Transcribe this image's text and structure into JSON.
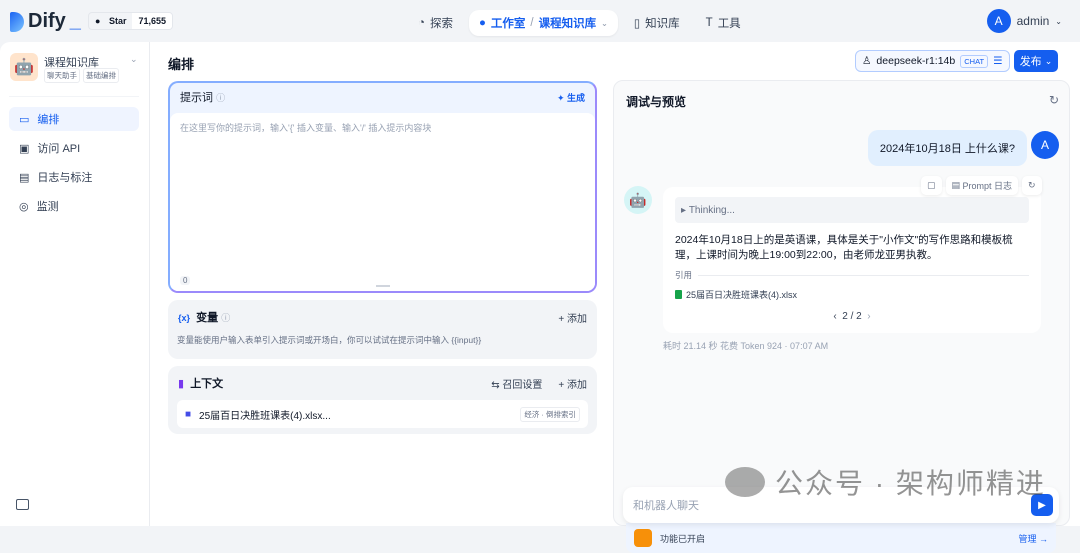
{
  "header": {
    "brand": "Dify",
    "github_star_label": "Star",
    "github_star_count": "71,655",
    "nav": [
      {
        "label": "探索",
        "icon": "compass-icon"
      },
      {
        "label": "工作室",
        "icon": "robot-icon"
      },
      {
        "label": "课程知识库"
      },
      {
        "label": "知识库",
        "icon": "book-icon"
      },
      {
        "label": "工具",
        "icon": "hammer-icon"
      }
    ],
    "breadcrumb_sep": "/",
    "user": {
      "initial": "A",
      "name": "admin"
    }
  },
  "sidebar": {
    "app_name": "课程知识库",
    "tags": [
      "聊天助手",
      "基础编排"
    ],
    "items": [
      {
        "label": "编排",
        "active": true
      },
      {
        "label": "访问 API"
      },
      {
        "label": "日志与标注"
      },
      {
        "label": "监测"
      }
    ]
  },
  "main": {
    "title": "编排",
    "model": {
      "name": "deepseek-r1:14b",
      "badge": "CHAT"
    },
    "publish_label": "发布",
    "prompt": {
      "label": "提示词",
      "generate": "生成",
      "placeholder": "在这里写你的提示词，输入'{' 插入变量、输入'/' 插入提示内容块",
      "count": "0"
    },
    "variables": {
      "label": "变量",
      "add": "添加",
      "description": "变量能使用户输入表单引入提示词或开场白，你可以试试在提示词中输入 {{input}}"
    },
    "context": {
      "label": "上下文",
      "recall": "召回设置",
      "add": "添加",
      "dataset": "25届百日决胜班课表(4).xlsx...",
      "dataset_badge": "经济 · 倒排索引"
    }
  },
  "debug": {
    "title": "调试与预览",
    "user_initial": "A",
    "user_message": "2024年10月18日 上什么课?",
    "actions": {
      "prompt_log": "Prompt 日志"
    },
    "thinking": "Thinking...",
    "answer": "2024年10月18日上的是英语课，具体是关于\"小作文\"的写作思路和模板梳理，上课时间为晚上19:00到22:00，由老师龙亚男执教。",
    "citation_label": "引用",
    "citation_file": "25届百日决胜班课表(4).xlsx",
    "pager": "2 / 2",
    "meta": "耗时 21.14 秒  花费 Token 924  ·  07:07 AM",
    "input_placeholder": "和机器人聊天",
    "features": "功能已开启",
    "manage": "管理 →"
  },
  "watermark": "公众号 · 架构师精进",
  "colors": {
    "accent": "#155eef",
    "background": "#f2f4f7"
  }
}
